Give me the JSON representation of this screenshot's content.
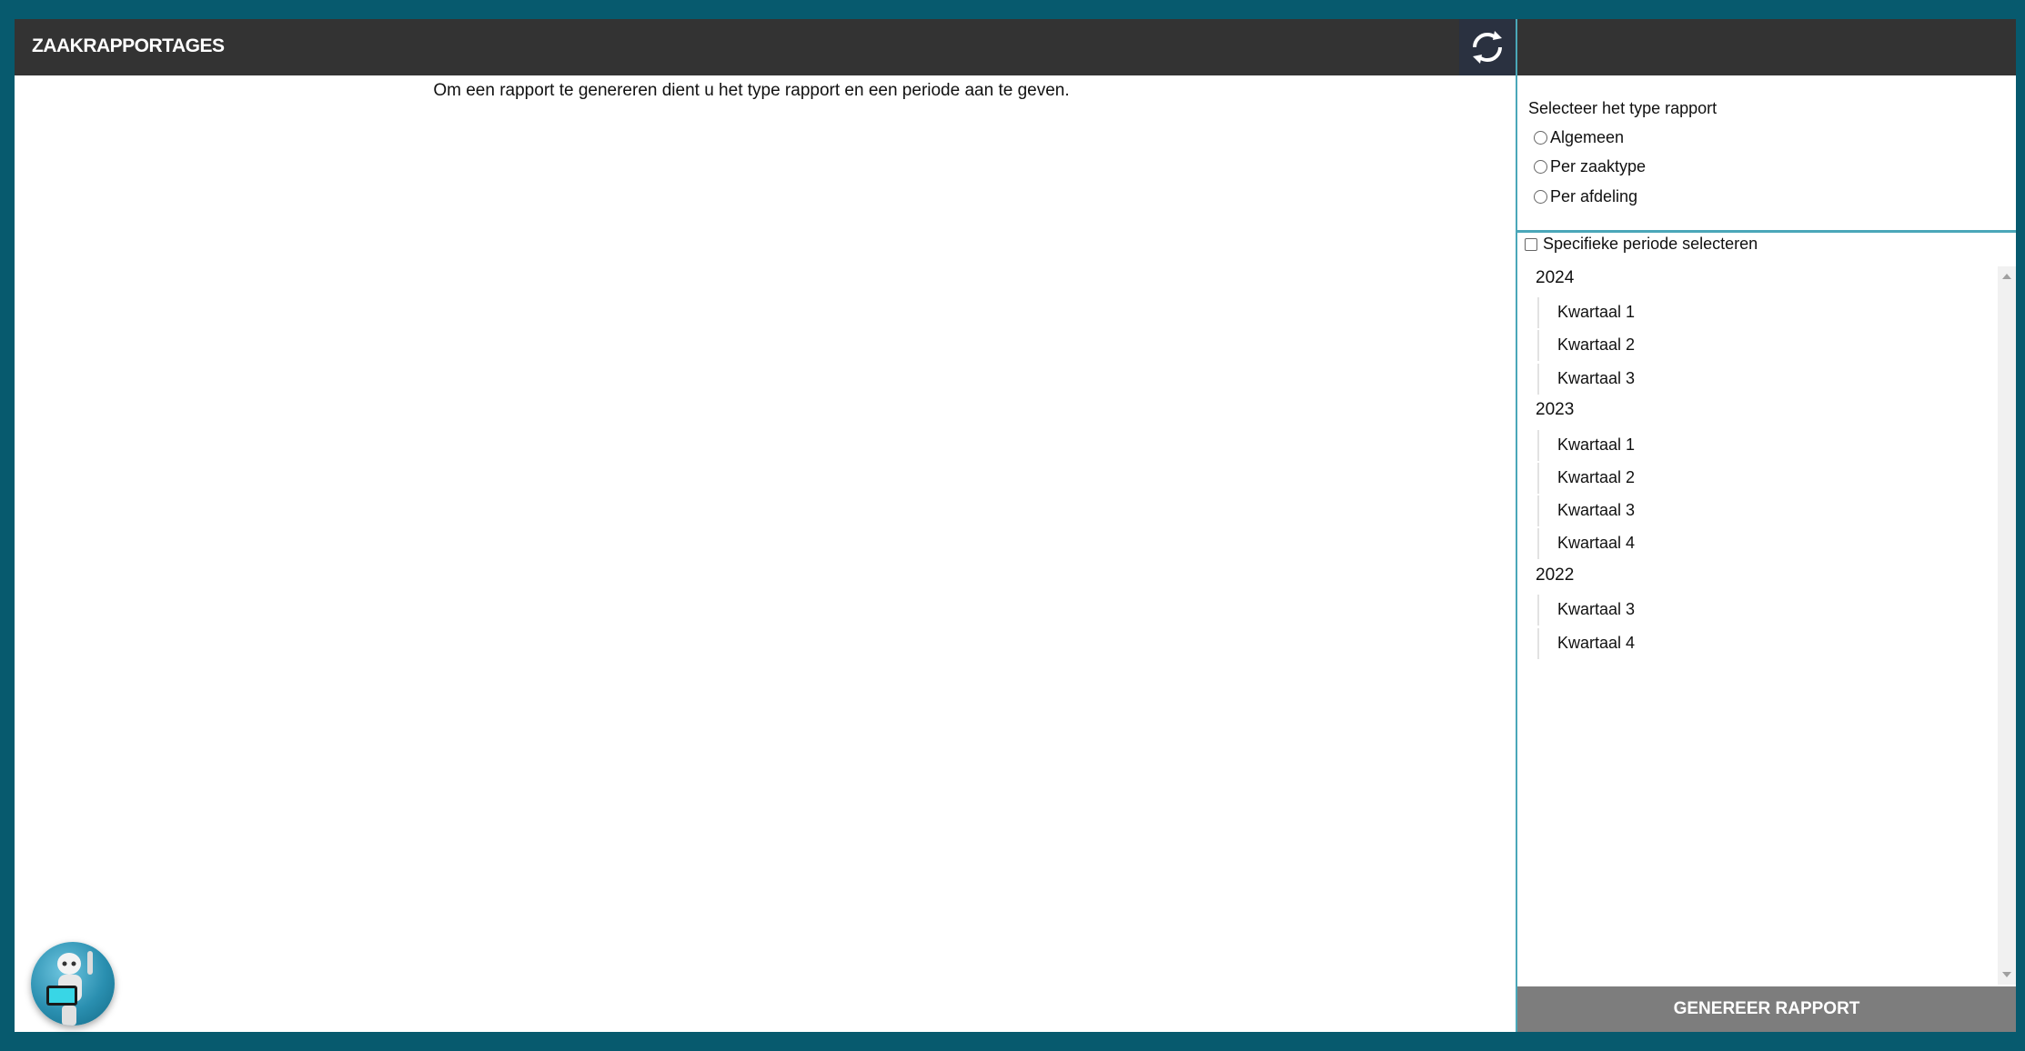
{
  "main": {
    "title": "ZAAKRAPPORTAGES",
    "message": "Om een rapport te genereren dient u het type rapport en een periode aan te geven.",
    "refresh_icon": "refresh-icon"
  },
  "sidebar": {
    "type_label": "Selecteer het type rapport",
    "report_types": [
      "Algemeen",
      "Per zaaktype",
      "Per afdeling"
    ],
    "period_checkbox_label": "Specifieke periode selecteren",
    "years": [
      {
        "year": "2024",
        "quarters": [
          "Kwartaal 1",
          "Kwartaal 2",
          "Kwartaal 3"
        ]
      },
      {
        "year": "2023",
        "quarters": [
          "Kwartaal 1",
          "Kwartaal 2",
          "Kwartaal 3",
          "Kwartaal 4"
        ]
      },
      {
        "year": "2022",
        "quarters": [
          "Kwartaal 3",
          "Kwartaal 4"
        ]
      }
    ],
    "generate_button": "GENEREER RAPPORT"
  },
  "assistant": {
    "icon": "robot-assistant-icon"
  },
  "colors": {
    "background": "#075a6e",
    "header": "#333333",
    "accent": "#4aa7b9",
    "button": "#7d7d7d"
  }
}
